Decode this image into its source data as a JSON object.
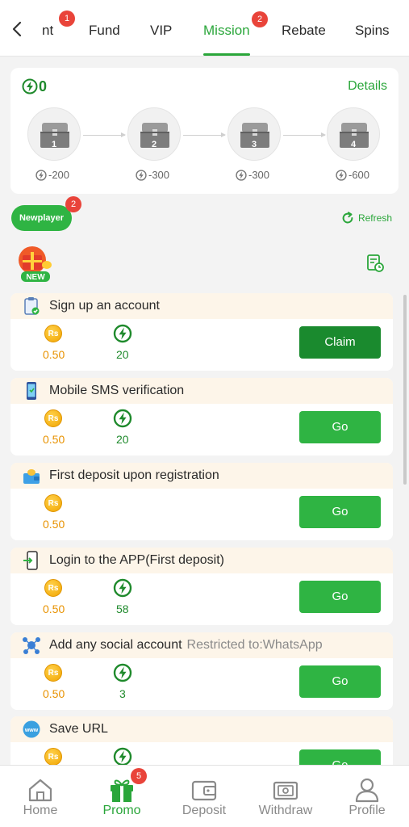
{
  "tabs": [
    {
      "label": "nt",
      "badge": "1"
    },
    {
      "label": "Fund"
    },
    {
      "label": "VIP"
    },
    {
      "label": "Mission",
      "badge": "2",
      "active": true
    },
    {
      "label": "Rebate"
    },
    {
      "label": "Spins"
    }
  ],
  "treasure": {
    "energy": "0",
    "details_label": "Details",
    "chests": [
      {
        "num": "1",
        "cost": "-200"
      },
      {
        "num": "2",
        "cost": "-300"
      },
      {
        "num": "3",
        "cost": "-300"
      },
      {
        "num": "4",
        "cost": "-600"
      }
    ]
  },
  "newplayer": {
    "label": "Newplayer",
    "badge": "2"
  },
  "refresh_label": "Refresh",
  "new_tag": "NEW",
  "currency_symbol": "Rs",
  "tasks": [
    {
      "title": "Sign up an account",
      "restriction": "",
      "rs": "0.50",
      "energy": "20",
      "button": "Claim"
    },
    {
      "title": "Mobile SMS verification",
      "restriction": "",
      "rs": "0.50",
      "energy": "20",
      "button": "Go"
    },
    {
      "title": "First deposit upon registration",
      "restriction": "",
      "rs": "0.50",
      "energy": "",
      "button": "Go"
    },
    {
      "title": "Login to the APP(First deposit)",
      "restriction": "",
      "rs": "0.50",
      "energy": "58",
      "button": "Go"
    },
    {
      "title": "Add any social account",
      "restriction": "Restricted to:WhatsApp",
      "rs": "0.50",
      "energy": "3",
      "button": "Go"
    },
    {
      "title": "Save URL",
      "restriction": "",
      "rs": "",
      "energy": "",
      "button": "Go"
    }
  ],
  "bottom_nav": [
    {
      "label": "Home"
    },
    {
      "label": "Promo",
      "badge": "5",
      "active": true
    },
    {
      "label": "Deposit"
    },
    {
      "label": "Withdraw"
    },
    {
      "label": "Profile"
    }
  ],
  "colors": {
    "brand_green": "#2aa63a",
    "button_green": "#2fb443",
    "claim_green": "#1a8a2e",
    "badge_red": "#e9443a",
    "coin": "#f1a400"
  }
}
